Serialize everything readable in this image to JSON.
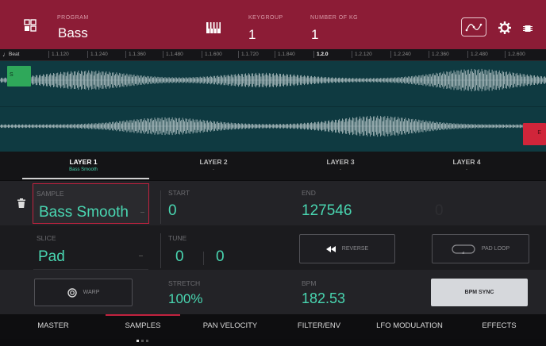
{
  "header": {
    "program_label": "PROGRAM",
    "program_value": "Bass",
    "keygroup_label": "KEYGROUP",
    "keygroup_value": "1",
    "number_label": "NUMBER OF KG",
    "number_value": "1",
    "icons": [
      "grid-menu-icon",
      "piano-keys-icon",
      "envelope-curve-icon",
      "gear-icon",
      "chip-icon"
    ]
  },
  "ruler": {
    "ticks": [
      "1.1.120",
      "1.1.240",
      "1.1.360",
      "1.1.480",
      "1.1.600",
      "1.1.720",
      "1.1.840",
      "1.2.0",
      "1.2.120",
      "1.2.240",
      "1.2.360",
      "1.2.480",
      "1.2.600"
    ],
    "beat_label": "Beat",
    "start_marker": "S",
    "end_marker": "E"
  },
  "layers": [
    {
      "title": "LAYER 1",
      "sub": "Bass Smooth"
    },
    {
      "title": "LAYER 2",
      "sub": "-"
    },
    {
      "title": "LAYER 3",
      "sub": "-"
    },
    {
      "title": "LAYER 4",
      "sub": "-"
    }
  ],
  "params": {
    "sample_label": "SAMPLE",
    "sample_value": "Bass Smooth",
    "start_label": "START",
    "start_value": "0",
    "end_label": "END",
    "end_value": "127546",
    "ghost_value": "0",
    "slice_label": "SLICE",
    "slice_value": "Pad",
    "tune_label": "TUNE",
    "tune_coarse": "0",
    "tune_fine": "0",
    "reverse_label": "REVERSE",
    "padloop_label": "PAD LOOP",
    "warp_label": "WARP",
    "stretch_label": "STRETCH",
    "stretch_value": "100%",
    "bpm_label": "BPM",
    "bpm_value": "182.53",
    "bpm_sync_label": "BPM SYNC"
  },
  "nav": [
    "MASTER",
    "SAMPLES",
    "PAN VELOCITY",
    "FILTER/ENV",
    "LFO MODULATION",
    "EFFECTS"
  ],
  "colors": {
    "header": "#8c1c36",
    "accent": "#49d6b1",
    "wave_bg": "#0f3a41",
    "active_tab": "#c2223f"
  }
}
